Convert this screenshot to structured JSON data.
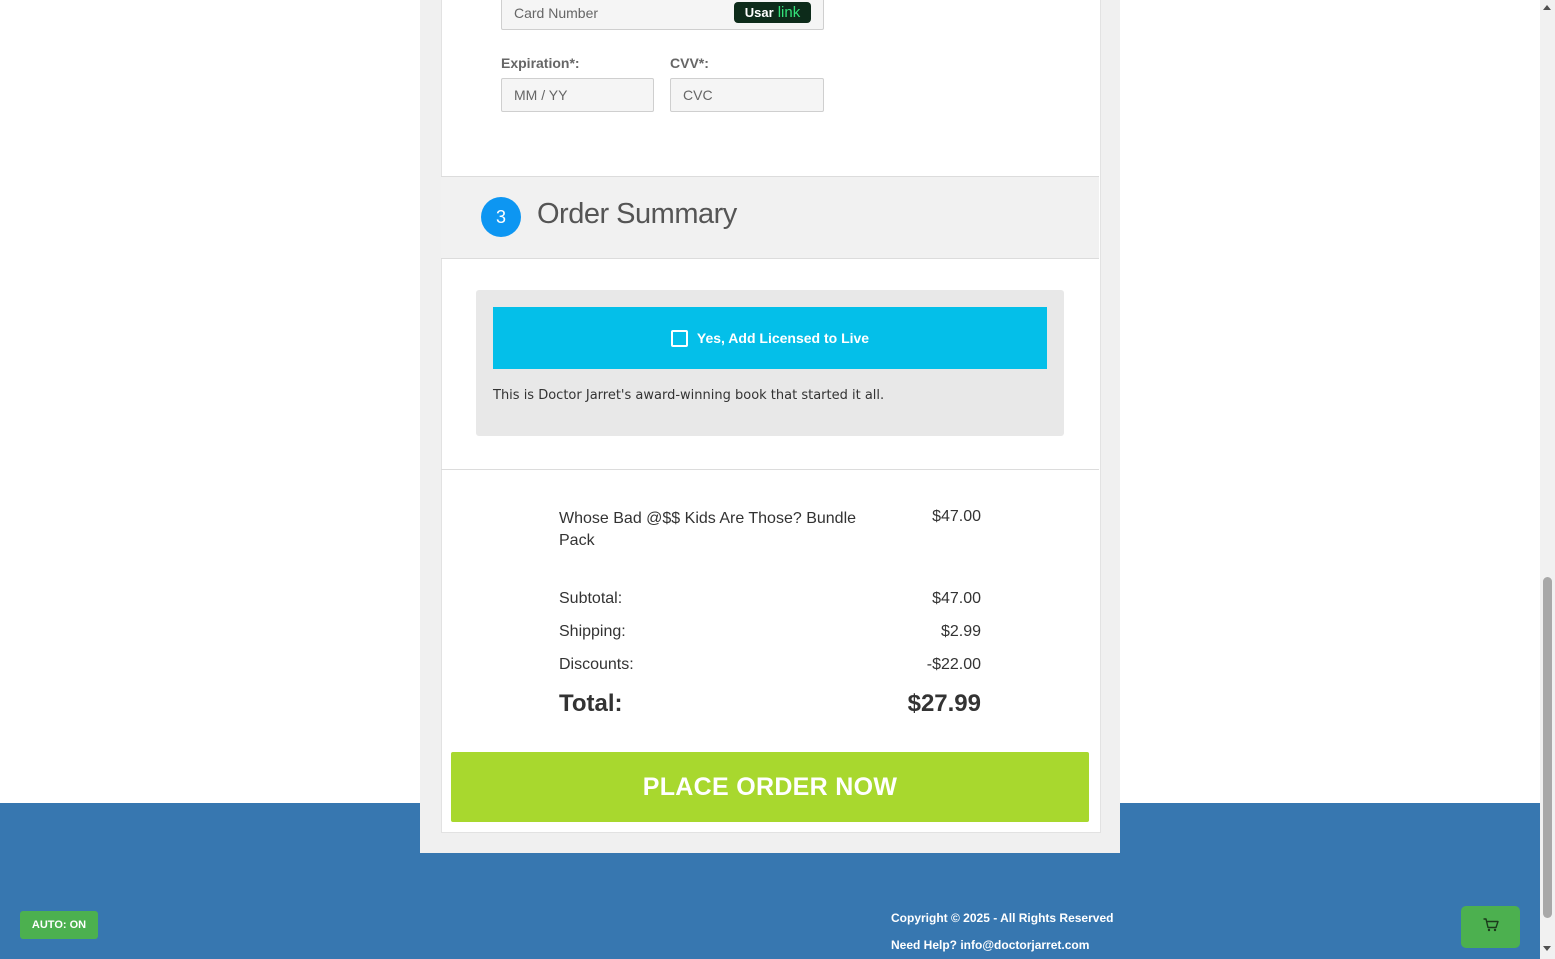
{
  "payment": {
    "card_number_placeholder": "Card Number",
    "link_badge_prefix": "Usar",
    "link_badge_brand": "link",
    "expiration_label": "Expiration*:",
    "expiration_placeholder": "MM / YY",
    "cvv_label": "CVV*:",
    "cvv_placeholder": "CVC"
  },
  "order_summary": {
    "step_number": "3",
    "title": "Order Summary",
    "upsell": {
      "checkbox_label": "Yes, Add Licensed to Live",
      "description": "This is Doctor Jarret's award-winning book that started it all."
    },
    "items": [
      {
        "name": "Whose Bad @$$ Kids Are Those? Bundle Pack",
        "price": "$47.00"
      }
    ],
    "subtotal_label": "Subtotal:",
    "subtotal_value": "$47.00",
    "shipping_label": "Shipping:",
    "shipping_value": "$2.99",
    "discounts_label": "Discounts:",
    "discounts_value": "-$22.00",
    "total_label": "Total:",
    "total_value": "$27.99",
    "place_order_label": "PLACE ORDER NOW"
  },
  "footer": {
    "auto_toggle_label": "AUTO: ON",
    "copyright": "Copyright © 2025 - All Rights Reserved",
    "help_text": "Need Help? info@doctorjarret.com",
    "cart_icon": "cart-icon"
  },
  "colors": {
    "footer_bg": "#3777b0",
    "step_circle": "#0d96f2",
    "upsell_button": "#04bfe9",
    "place_order_button": "#a8d82e",
    "green_button": "#4cb04f"
  }
}
